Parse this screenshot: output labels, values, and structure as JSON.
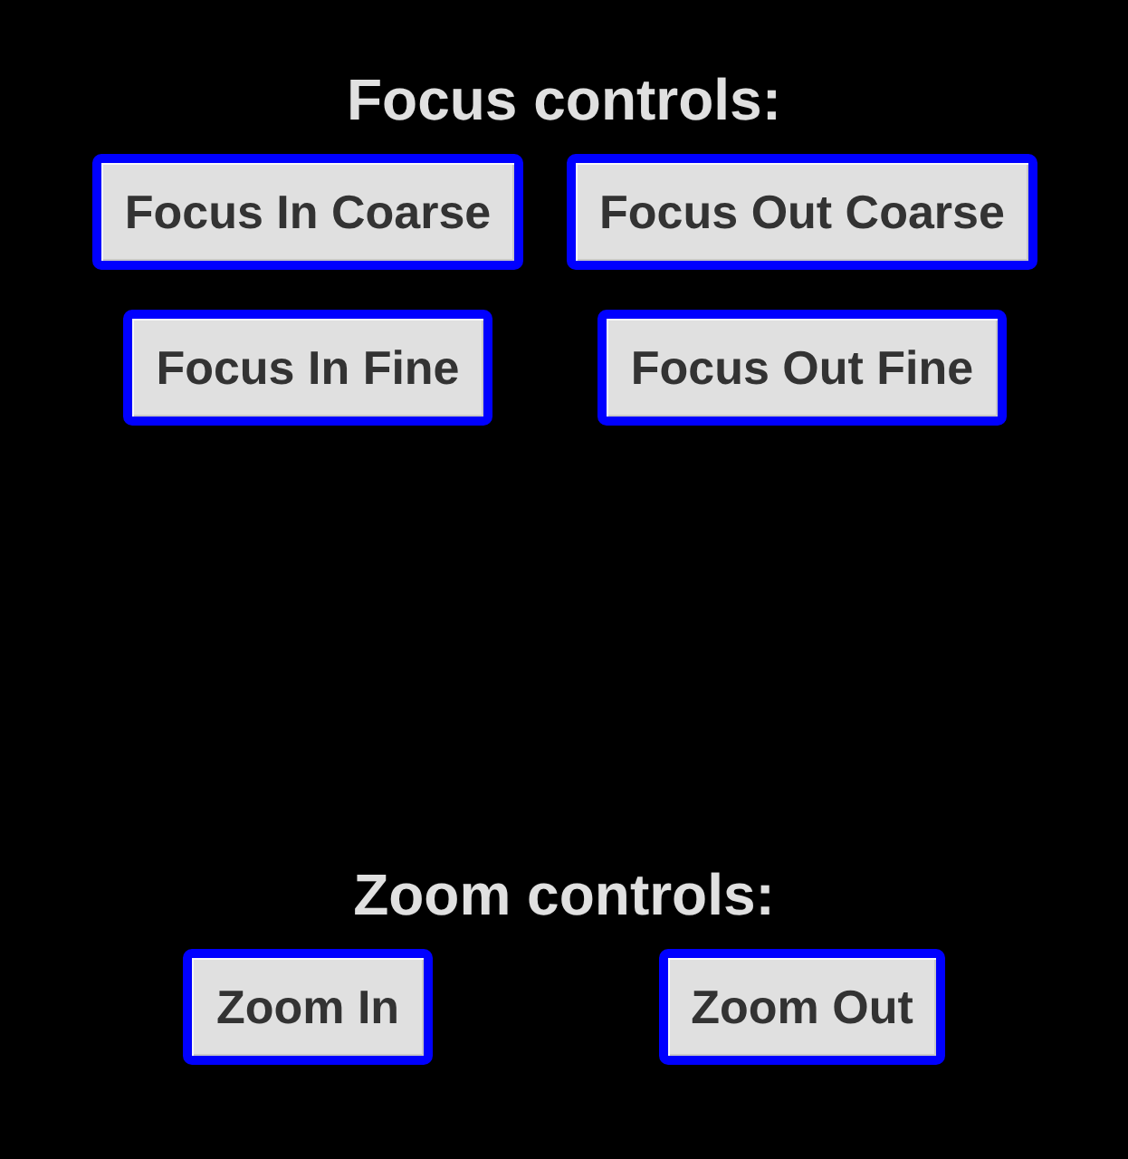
{
  "sections": [
    {
      "title": "Focus controls:",
      "buttons": [
        "Focus In Coarse",
        "Focus Out Coarse",
        "Focus In Fine",
        "Focus Out Fine"
      ]
    },
    {
      "title": "Zoom controls:",
      "buttons": [
        "Zoom In",
        "Zoom Out"
      ]
    }
  ]
}
